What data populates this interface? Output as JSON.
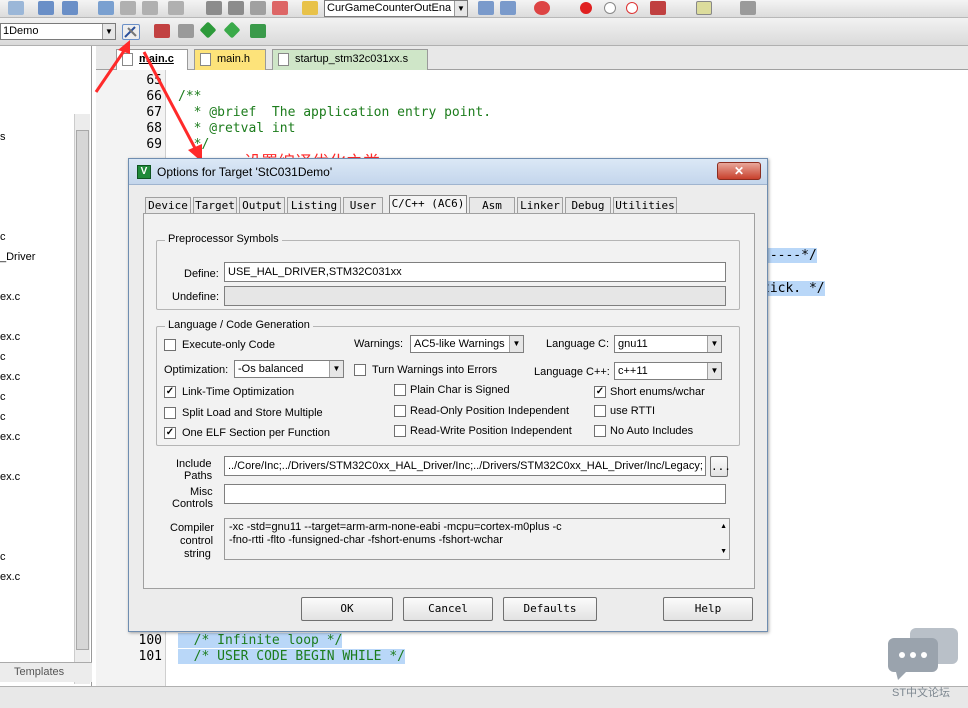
{
  "toolbar": {
    "target_combo": "1Demo",
    "function_combo": "CurGameCounterOutEna"
  },
  "editor": {
    "tabs": [
      {
        "label": "main.c"
      },
      {
        "label": "main.h"
      },
      {
        "label": "startup_stm32c031xx.s"
      }
    ],
    "lines": [
      {
        "num": "65",
        "text": ""
      },
      {
        "num": "66",
        "text": "/**"
      },
      {
        "num": "67",
        "text": "  * @brief  The application entry point."
      },
      {
        "num": "68",
        "text": "  * @retval int"
      },
      {
        "num": "69",
        "text": "  */"
      },
      {
        "num": "100",
        "text": "  /* Infinite loop */"
      },
      {
        "num": "101",
        "text": "  /* USER CODE BEGIN WHILE */"
      }
    ],
    "right_fragment_1": "-----*/",
    "right_fragment_2": "tick. */"
  },
  "left_panel": {
    "items": [
      "s",
      "c",
      "_Driver",
      "ex.c",
      "ex.c",
      "c",
      "ex.c",
      "c",
      "c",
      "ex.c",
      "ex.c",
      "c",
      "ex.c"
    ],
    "tab_label": "Templates"
  },
  "annotation": "设置编译优化之类",
  "dialog": {
    "title": "Options for Target 'StC031Demo'",
    "close": "✕",
    "tabs": [
      "Device",
      "Target",
      "Output",
      "Listing",
      "User",
      "C/C++ (AC6)",
      "Asm",
      "Linker",
      "Debug",
      "Utilities"
    ],
    "preprocessor": {
      "group_title": "Preprocessor Symbols",
      "define_label": "Define:",
      "define_value": "USE_HAL_DRIVER,STM32C031xx",
      "undefine_label": "Undefine:",
      "undefine_value": ""
    },
    "language": {
      "group_title": "Language / Code Generation",
      "execute_only": {
        "label": "Execute-only Code",
        "checked": false
      },
      "warnings_label": "Warnings:",
      "warnings_value": "AC5-like Warnings",
      "language_c_label": "Language C:",
      "language_c_value": "gnu11",
      "optimization_label": "Optimization:",
      "optimization_value": "-Os balanced",
      "turn_warnings": {
        "label": "Turn Warnings into Errors",
        "checked": false
      },
      "language_cpp_label": "Language C++:",
      "language_cpp_value": "c++11",
      "lto": {
        "label": "Link-Time Optimization",
        "checked": true
      },
      "plain_char": {
        "label": "Plain Char is Signed",
        "checked": false
      },
      "short_enums": {
        "label": "Short enums/wchar",
        "checked": true
      },
      "split_load": {
        "label": "Split Load and Store Multiple",
        "checked": false
      },
      "ro_pi": {
        "label": "Read-Only Position Independent",
        "checked": false
      },
      "use_rtti": {
        "label": "use RTTI",
        "checked": false
      },
      "one_elf": {
        "label": "One ELF Section per Function",
        "checked": true
      },
      "rw_pi": {
        "label": "Read-Write Position Independent",
        "checked": false
      },
      "no_auto_includes": {
        "label": "No Auto Includes",
        "checked": false
      }
    },
    "include_paths_label_1": "Include",
    "include_paths_label_2": "Paths",
    "include_paths_value": "../Core/Inc;../Drivers/STM32C0xx_HAL_Driver/Inc;../Drivers/STM32C0xx_HAL_Driver/Inc/Legacy;",
    "browse": "...",
    "misc_label_1": "Misc",
    "misc_label_2": "Controls",
    "misc_value": "",
    "compiler_label_1": "Compiler",
    "compiler_label_2": "control",
    "compiler_label_3": "string",
    "compiler_line_1": "-xc -std=gnu11 --target=arm-arm-none-eabi -mcpu=cortex-m0plus -c",
    "compiler_line_2": "-fno-rtti -flto -funsigned-char -fshort-enums -fshort-wchar",
    "buttons": {
      "ok": "OK",
      "cancel": "Cancel",
      "defaults": "Defaults",
      "help": "Help"
    }
  },
  "watermark": "ST中文论坛"
}
